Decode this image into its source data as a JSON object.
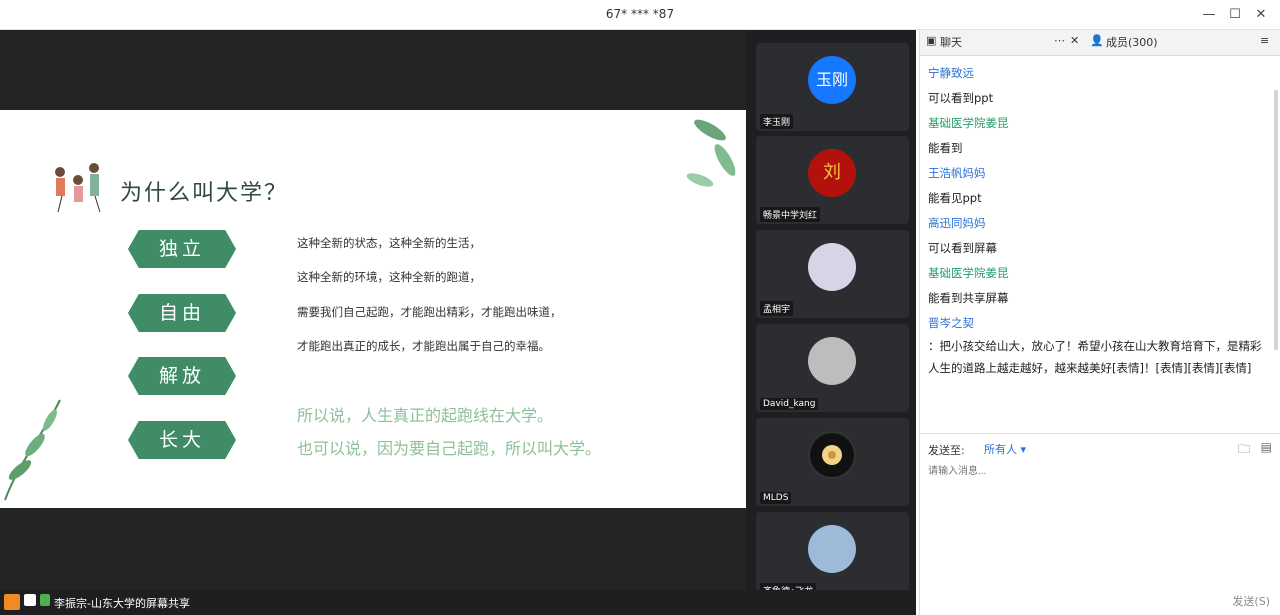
{
  "window": {
    "title": "67* *** *87",
    "min_glyph": "—",
    "max_glyph": "☐",
    "close_glyph": "✕"
  },
  "slide": {
    "title": "为什么叫大学？",
    "tags": [
      "独立",
      "自由",
      "解放",
      "长大"
    ],
    "lines": [
      "这种全新的状态，这种全新的生活，",
      "这种全新的环境，这种全新的跑道，",
      "需要我们自己起跑，才能跑出精彩，才能跑出味道，",
      "才能跑出真正的成长，才能跑出属于自己的幸福。"
    ],
    "highlight": [
      "所以说，人生真正的起跑线在大学。",
      "也可以说，因为要自己起跑，所以叫大学。"
    ]
  },
  "participants": [
    {
      "label": "李玉刚",
      "avatar_text": "玉刚",
      "color": "#1677ff"
    },
    {
      "label": "畅景中学刘红",
      "avatar_text": "刘",
      "color": "#b3120c"
    },
    {
      "label": "孟相宇",
      "avatar_text": "",
      "color": "#d8d4e8"
    },
    {
      "label": "David_kang",
      "avatar_text": "",
      "color": "#bdbdbd"
    },
    {
      "label": "MLDS",
      "avatar_text": "",
      "color": "#1a1a1a"
    },
    {
      "label": "齐鲁德•飞龙",
      "avatar_text": "",
      "color": "#9dbbd8"
    }
  ],
  "share_label": "李振宗-山东大学的屏幕共享",
  "chat": {
    "tab_chat": "聊天",
    "tab_members": "成员(300)",
    "messages": [
      {
        "who": "宁静致远",
        "style": "name"
      },
      {
        "who": "可以看到ppt",
        "style": "txt"
      },
      {
        "who": "基础医学院姜昆",
        "style": "name-green"
      },
      {
        "who": "能看到",
        "style": "txt"
      },
      {
        "who": "王浩帆妈妈",
        "style": "name"
      },
      {
        "who": "能看见ppt",
        "style": "txt"
      },
      {
        "who": "高迅同妈妈",
        "style": "name"
      },
      {
        "who": "可以看到屏幕",
        "style": "txt"
      },
      {
        "who": "基础医学院姜昆",
        "style": "name-green"
      },
      {
        "who": "能看到共享屏幕",
        "style": "txt"
      },
      {
        "who": "晋岑之契",
        "style": "name"
      }
    ],
    "long_msg": "：把小孩交给山大，放心了！希望小孩在山大教育培育下，是精彩人生的道路上越走越好，越来越美好[表情]！[表情][表情][表情]",
    "send_to_label": "发送至:",
    "send_to_value": "所有人",
    "input_placeholder": "请输入消息...",
    "send_button": "发送(S)"
  }
}
